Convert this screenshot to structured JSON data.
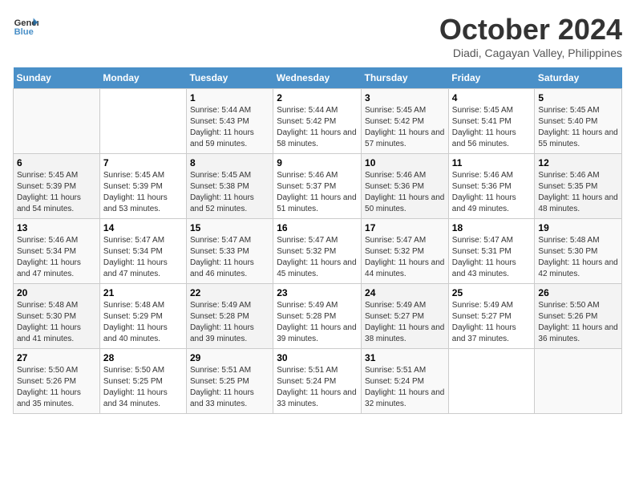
{
  "logo": {
    "line1": "General",
    "line2": "Blue"
  },
  "title": "October 2024",
  "subtitle": "Diadi, Cagayan Valley, Philippines",
  "weekdays": [
    "Sunday",
    "Monday",
    "Tuesday",
    "Wednesday",
    "Thursday",
    "Friday",
    "Saturday"
  ],
  "weeks": [
    [
      {
        "day": "",
        "info": ""
      },
      {
        "day": "",
        "info": ""
      },
      {
        "day": "1",
        "info": "Sunrise: 5:44 AM\nSunset: 5:43 PM\nDaylight: 11 hours and 59 minutes."
      },
      {
        "day": "2",
        "info": "Sunrise: 5:44 AM\nSunset: 5:42 PM\nDaylight: 11 hours and 58 minutes."
      },
      {
        "day": "3",
        "info": "Sunrise: 5:45 AM\nSunset: 5:42 PM\nDaylight: 11 hours and 57 minutes."
      },
      {
        "day": "4",
        "info": "Sunrise: 5:45 AM\nSunset: 5:41 PM\nDaylight: 11 hours and 56 minutes."
      },
      {
        "day": "5",
        "info": "Sunrise: 5:45 AM\nSunset: 5:40 PM\nDaylight: 11 hours and 55 minutes."
      }
    ],
    [
      {
        "day": "6",
        "info": "Sunrise: 5:45 AM\nSunset: 5:39 PM\nDaylight: 11 hours and 54 minutes."
      },
      {
        "day": "7",
        "info": "Sunrise: 5:45 AM\nSunset: 5:39 PM\nDaylight: 11 hours and 53 minutes."
      },
      {
        "day": "8",
        "info": "Sunrise: 5:45 AM\nSunset: 5:38 PM\nDaylight: 11 hours and 52 minutes."
      },
      {
        "day": "9",
        "info": "Sunrise: 5:46 AM\nSunset: 5:37 PM\nDaylight: 11 hours and 51 minutes."
      },
      {
        "day": "10",
        "info": "Sunrise: 5:46 AM\nSunset: 5:36 PM\nDaylight: 11 hours and 50 minutes."
      },
      {
        "day": "11",
        "info": "Sunrise: 5:46 AM\nSunset: 5:36 PM\nDaylight: 11 hours and 49 minutes."
      },
      {
        "day": "12",
        "info": "Sunrise: 5:46 AM\nSunset: 5:35 PM\nDaylight: 11 hours and 48 minutes."
      }
    ],
    [
      {
        "day": "13",
        "info": "Sunrise: 5:46 AM\nSunset: 5:34 PM\nDaylight: 11 hours and 47 minutes."
      },
      {
        "day": "14",
        "info": "Sunrise: 5:47 AM\nSunset: 5:34 PM\nDaylight: 11 hours and 47 minutes."
      },
      {
        "day": "15",
        "info": "Sunrise: 5:47 AM\nSunset: 5:33 PM\nDaylight: 11 hours and 46 minutes."
      },
      {
        "day": "16",
        "info": "Sunrise: 5:47 AM\nSunset: 5:32 PM\nDaylight: 11 hours and 45 minutes."
      },
      {
        "day": "17",
        "info": "Sunrise: 5:47 AM\nSunset: 5:32 PM\nDaylight: 11 hours and 44 minutes."
      },
      {
        "day": "18",
        "info": "Sunrise: 5:47 AM\nSunset: 5:31 PM\nDaylight: 11 hours and 43 minutes."
      },
      {
        "day": "19",
        "info": "Sunrise: 5:48 AM\nSunset: 5:30 PM\nDaylight: 11 hours and 42 minutes."
      }
    ],
    [
      {
        "day": "20",
        "info": "Sunrise: 5:48 AM\nSunset: 5:30 PM\nDaylight: 11 hours and 41 minutes."
      },
      {
        "day": "21",
        "info": "Sunrise: 5:48 AM\nSunset: 5:29 PM\nDaylight: 11 hours and 40 minutes."
      },
      {
        "day": "22",
        "info": "Sunrise: 5:49 AM\nSunset: 5:28 PM\nDaylight: 11 hours and 39 minutes."
      },
      {
        "day": "23",
        "info": "Sunrise: 5:49 AM\nSunset: 5:28 PM\nDaylight: 11 hours and 39 minutes."
      },
      {
        "day": "24",
        "info": "Sunrise: 5:49 AM\nSunset: 5:27 PM\nDaylight: 11 hours and 38 minutes."
      },
      {
        "day": "25",
        "info": "Sunrise: 5:49 AM\nSunset: 5:27 PM\nDaylight: 11 hours and 37 minutes."
      },
      {
        "day": "26",
        "info": "Sunrise: 5:50 AM\nSunset: 5:26 PM\nDaylight: 11 hours and 36 minutes."
      }
    ],
    [
      {
        "day": "27",
        "info": "Sunrise: 5:50 AM\nSunset: 5:26 PM\nDaylight: 11 hours and 35 minutes."
      },
      {
        "day": "28",
        "info": "Sunrise: 5:50 AM\nSunset: 5:25 PM\nDaylight: 11 hours and 34 minutes."
      },
      {
        "day": "29",
        "info": "Sunrise: 5:51 AM\nSunset: 5:25 PM\nDaylight: 11 hours and 33 minutes."
      },
      {
        "day": "30",
        "info": "Sunrise: 5:51 AM\nSunset: 5:24 PM\nDaylight: 11 hours and 33 minutes."
      },
      {
        "day": "31",
        "info": "Sunrise: 5:51 AM\nSunset: 5:24 PM\nDaylight: 11 hours and 32 minutes."
      },
      {
        "day": "",
        "info": ""
      },
      {
        "day": "",
        "info": ""
      }
    ]
  ]
}
